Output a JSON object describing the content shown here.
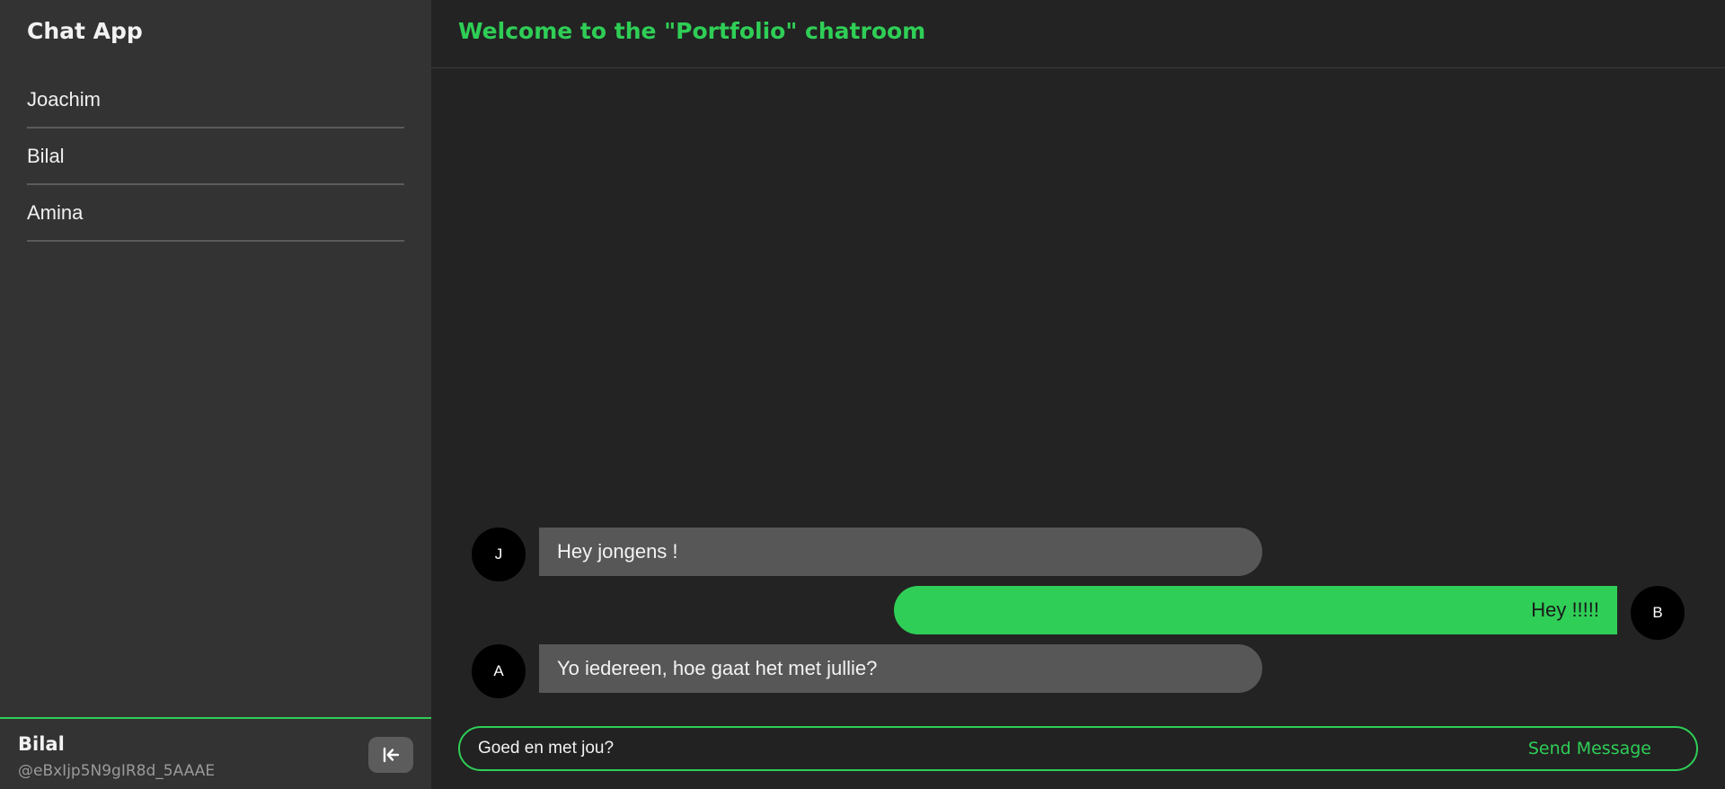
{
  "sidebar": {
    "app_title": "Chat App",
    "users": [
      {
        "name": "Joachim"
      },
      {
        "name": "Bilal"
      },
      {
        "name": "Amina"
      }
    ],
    "current_user": {
      "name": "Bilal",
      "handle": "@eBxIjp5N9gIR8d_5AAAE"
    },
    "logout_icon": "arrow-left-to-line-icon"
  },
  "room": {
    "title": "Welcome to the \"Portfolio\" chatroom"
  },
  "messages": [
    {
      "avatar_letter": "J",
      "text": "Hey jongens !",
      "direction": "incoming"
    },
    {
      "avatar_letter": "B",
      "text": "Hey !!!!!",
      "direction": "outgoing"
    },
    {
      "avatar_letter": "A",
      "text": "Yo iedereen, hoe gaat het met jullie?",
      "direction": "incoming"
    }
  ],
  "composer": {
    "value": "Goed en met jou?",
    "send_label": "Send Message"
  },
  "colors": {
    "accent": "#2fce56",
    "sidebar_bg": "#333333",
    "main_bg": "#232323",
    "incoming_bubble": "#575757",
    "avatar_bg": "#000000"
  }
}
